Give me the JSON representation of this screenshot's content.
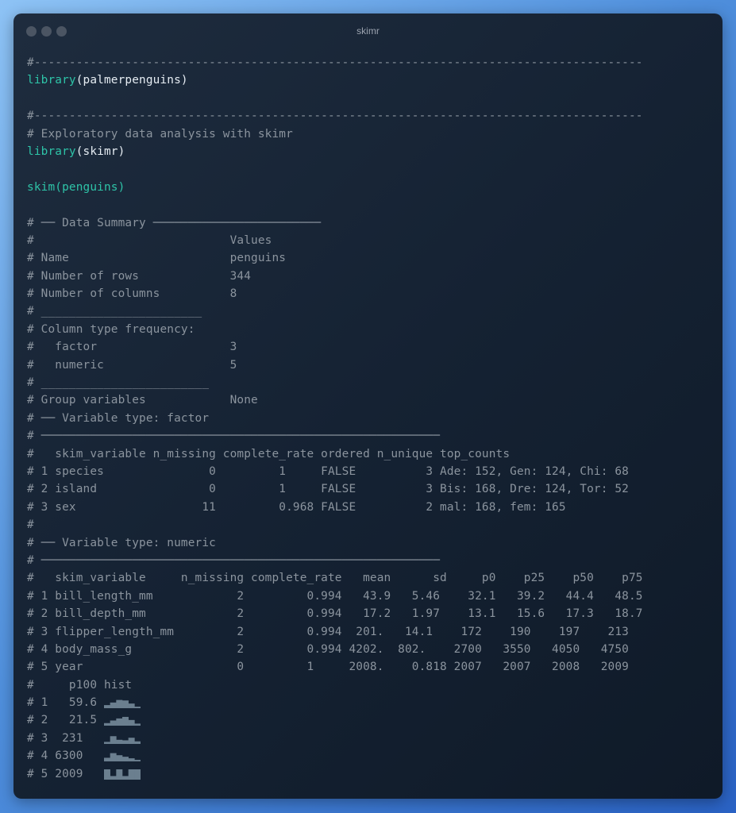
{
  "window": {
    "title": "skimr"
  },
  "colors": {
    "function": "#2ec4a8",
    "plain": "#e6edf3",
    "comment": "#8b949e",
    "hist": "#6b7f8f"
  },
  "lines": [
    {
      "segments": [
        {
          "t": "#---------------------------------------------------------------------------------------",
          "c": "comment"
        }
      ]
    },
    {
      "segments": [
        {
          "t": "library",
          "c": "fn"
        },
        {
          "t": "(palmerpenguins)",
          "c": "plain"
        }
      ]
    },
    {
      "segments": []
    },
    {
      "segments": [
        {
          "t": "#---------------------------------------------------------------------------------------",
          "c": "comment"
        }
      ]
    },
    {
      "segments": [
        {
          "t": "# Exploratory data analysis with skimr",
          "c": "comment"
        }
      ]
    },
    {
      "segments": [
        {
          "t": "library",
          "c": "fn"
        },
        {
          "t": "(skimr)",
          "c": "plain"
        }
      ]
    },
    {
      "segments": []
    },
    {
      "segments": [
        {
          "t": "skim(penguins)",
          "c": "cyan"
        }
      ]
    },
    {
      "segments": []
    },
    {
      "segments": [
        {
          "t": "# ── Data Summary ────────────────────────",
          "c": "comment"
        }
      ]
    },
    {
      "segments": [
        {
          "t": "#                            Values",
          "c": "comment"
        }
      ]
    },
    {
      "segments": [
        {
          "t": "# Name                       penguins",
          "c": "comment"
        }
      ]
    },
    {
      "segments": [
        {
          "t": "# Number of rows             344",
          "c": "comment"
        }
      ]
    },
    {
      "segments": [
        {
          "t": "# Number of columns          8",
          "c": "comment"
        }
      ]
    },
    {
      "segments": [
        {
          "t": "# _______________________",
          "c": "comment"
        }
      ]
    },
    {
      "segments": [
        {
          "t": "# Column type frequency:",
          "c": "comment"
        }
      ]
    },
    {
      "segments": [
        {
          "t": "#   factor                   3",
          "c": "comment"
        }
      ]
    },
    {
      "segments": [
        {
          "t": "#   numeric                  5",
          "c": "comment"
        }
      ]
    },
    {
      "segments": [
        {
          "t": "# ________________________",
          "c": "comment"
        }
      ]
    },
    {
      "segments": [
        {
          "t": "# Group variables            None",
          "c": "comment"
        }
      ]
    },
    {
      "segments": [
        {
          "t": "# ── Variable type: factor",
          "c": "comment"
        }
      ]
    },
    {
      "segments": [
        {
          "t": "# ─────────────────────────────────────────────────────────",
          "c": "comment"
        }
      ]
    },
    {
      "segments": [
        {
          "t": "#   skim_variable n_missing complete_rate ordered n_unique top_counts",
          "c": "comment"
        }
      ]
    },
    {
      "segments": [
        {
          "t": "# 1 species               0         1     FALSE          3 Ade: 152, Gen: 124, Chi: 68",
          "c": "comment"
        }
      ]
    },
    {
      "segments": [
        {
          "t": "# 2 island                0         1     FALSE          3 Bis: 168, Dre: 124, Tor: 52",
          "c": "comment"
        }
      ]
    },
    {
      "segments": [
        {
          "t": "# 3 sex                  11         0.968 FALSE          2 mal: 168, fem: 165",
          "c": "comment"
        }
      ]
    },
    {
      "segments": [
        {
          "t": "#",
          "c": "comment"
        }
      ]
    },
    {
      "segments": [
        {
          "t": "# ── Variable type: numeric",
          "c": "comment"
        }
      ]
    },
    {
      "segments": [
        {
          "t": "# ─────────────────────────────────────────────────────────",
          "c": "comment"
        }
      ]
    },
    {
      "segments": [
        {
          "t": "#   skim_variable     n_missing complete_rate   mean      sd     p0    p25    p50    p75",
          "c": "comment"
        }
      ]
    },
    {
      "segments": [
        {
          "t": "# 1 bill_length_mm            2         0.994   43.9   5.46    32.1   39.2   44.4   48.5",
          "c": "comment"
        }
      ]
    },
    {
      "segments": [
        {
          "t": "# 2 bill_depth_mm             2         0.994   17.2   1.97    13.1   15.6   17.3   18.7",
          "c": "comment"
        }
      ]
    },
    {
      "segments": [
        {
          "t": "# 3 flipper_length_mm         2         0.994  201.   14.1    172    190    197    213",
          "c": "comment"
        }
      ]
    },
    {
      "segments": [
        {
          "t": "# 4 body_mass_g               2         0.994 4202.  802.    2700   3550   4050   4750",
          "c": "comment"
        }
      ]
    },
    {
      "segments": [
        {
          "t": "# 5 year                      0         1     2008.    0.818 2007   2007   2008   2009",
          "c": "comment"
        }
      ]
    },
    {
      "segments": [
        {
          "t": "#     p100 hist",
          "c": "comment"
        }
      ]
    },
    {
      "segments": [
        {
          "t": "# 1   59.6 ",
          "c": "comment"
        }
      ],
      "hist": [
        0.3,
        0.55,
        0.8,
        0.75,
        0.45,
        0.15
      ]
    },
    {
      "segments": [
        {
          "t": "# 2   21.5 ",
          "c": "comment"
        }
      ],
      "hist": [
        0.25,
        0.5,
        0.7,
        0.85,
        0.55,
        0.2
      ]
    },
    {
      "segments": [
        {
          "t": "# 3  231   ",
          "c": "comment"
        }
      ],
      "hist": [
        0.2,
        0.75,
        0.4,
        0.35,
        0.6,
        0.25
      ]
    },
    {
      "segments": [
        {
          "t": "# 4 6300   ",
          "c": "comment"
        }
      ],
      "hist": [
        0.35,
        0.8,
        0.6,
        0.45,
        0.3,
        0.15
      ]
    },
    {
      "segments": [
        {
          "t": "# 5 2009   ",
          "c": "comment"
        }
      ],
      "hist": [
        1.0,
        0.35,
        1.0,
        0.35,
        1.0,
        1.0
      ]
    }
  ]
}
